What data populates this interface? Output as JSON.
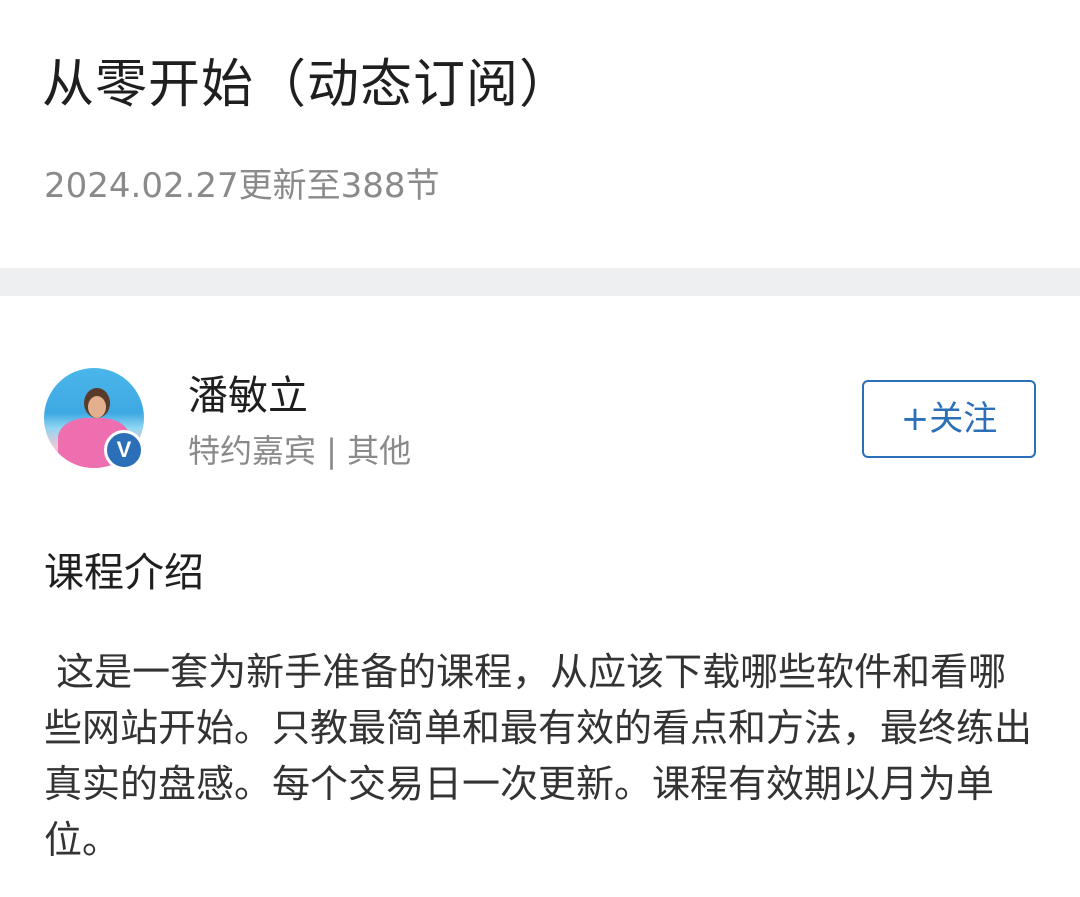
{
  "header": {
    "title": "从零开始（动态订阅）",
    "update_info": "2024.02.27更新至388节"
  },
  "author": {
    "name": "潘敏立",
    "description": "特约嘉宾 | 其他",
    "verified_badge": "V",
    "avatar_icon": "avatar-photo",
    "follow_label": "+关注",
    "accent_color": "#2a6fb7"
  },
  "course": {
    "section_title": "课程介绍",
    "description": " 这是一套为新手准备的课程，从应该下载哪些软件和看哪些网站开始。只教最简单和最有效的看点和方法，最终练出真实的盘感。每个交易日一次更新。课程有效期以月为单位。"
  }
}
